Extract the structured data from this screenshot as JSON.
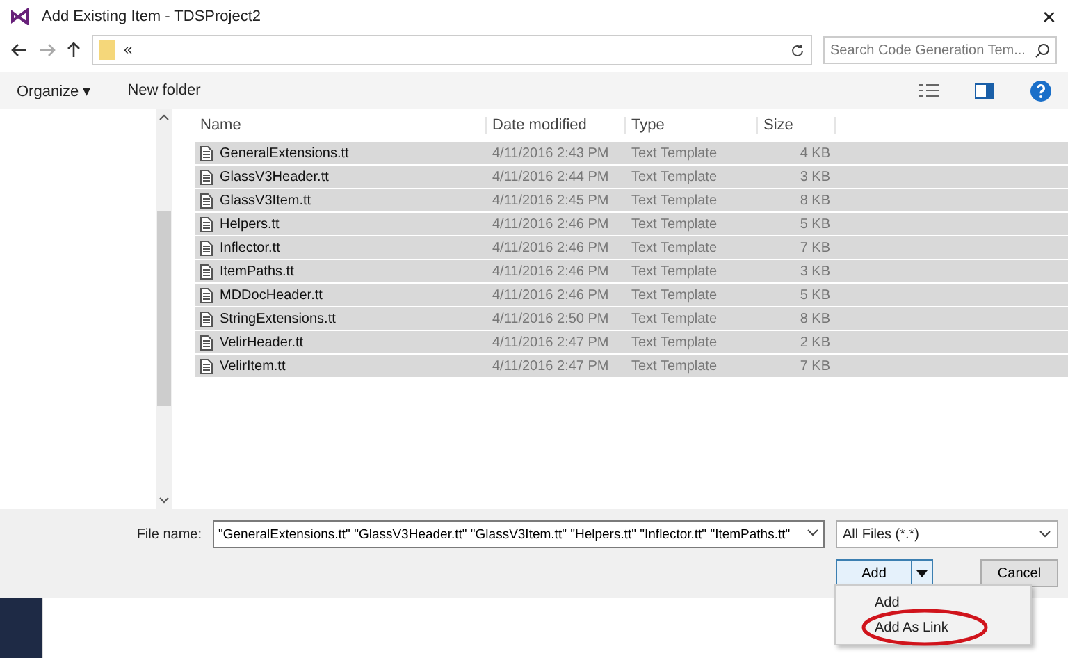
{
  "window": {
    "title": "Add Existing Item - TDSProject2",
    "close": "✕"
  },
  "address": {
    "path": "«",
    "search_placeholder": "Search Code Generation Tem..."
  },
  "toolbar": {
    "organize": "Organize ▾",
    "new_folder": "New folder"
  },
  "table": {
    "columns": [
      "Name",
      "Date modified",
      "Type",
      "Size"
    ],
    "rows": [
      {
        "name": "GeneralExtensions.tt",
        "date": "4/11/2016 2:43 PM",
        "type": "Text Template",
        "size": "4 KB",
        "selected": true
      },
      {
        "name": "GlassV3Header.tt",
        "date": "4/11/2016 2:44 PM",
        "type": "Text Template",
        "size": "3 KB",
        "selected": true
      },
      {
        "name": "GlassV3Item.tt",
        "date": "4/11/2016 2:45 PM",
        "type": "Text Template",
        "size": "8 KB",
        "selected": true
      },
      {
        "name": "Helpers.tt",
        "date": "4/11/2016 2:46 PM",
        "type": "Text Template",
        "size": "5 KB",
        "selected": true
      },
      {
        "name": "Inflector.tt",
        "date": "4/11/2016 2:46 PM",
        "type": "Text Template",
        "size": "7 KB",
        "selected": true
      },
      {
        "name": "ItemPaths.tt",
        "date": "4/11/2016 2:46 PM",
        "type": "Text Template",
        "size": "3 KB",
        "selected": true
      },
      {
        "name": "MDDocHeader.tt",
        "date": "4/11/2016 2:46 PM",
        "type": "Text Template",
        "size": "5 KB",
        "selected": true
      },
      {
        "name": "StringExtensions.tt",
        "date": "4/11/2016 2:50 PM",
        "type": "Text Template",
        "size": "8 KB",
        "selected": true
      },
      {
        "name": "VelirHeader.tt",
        "date": "4/11/2016 2:47 PM",
        "type": "Text Template",
        "size": "2 KB",
        "selected": true
      },
      {
        "name": "VelirItem.tt",
        "date": "4/11/2016 2:47 PM",
        "type": "Text Template",
        "size": "7 KB",
        "selected": true
      }
    ]
  },
  "footer": {
    "file_name_label": "File name:",
    "file_name_value": "\"GeneralExtensions.tt\" \"GlassV3Header.tt\" \"GlassV3Item.tt\" \"Helpers.tt\" \"Inflector.tt\" \"ItemPaths.tt\"",
    "filter": "All Files (*.*)",
    "add": "Add",
    "cancel": "Cancel"
  },
  "menu": {
    "items": [
      {
        "label": "Add",
        "highlighted": false
      },
      {
        "label": "Add As Link",
        "highlighted": true
      }
    ]
  }
}
